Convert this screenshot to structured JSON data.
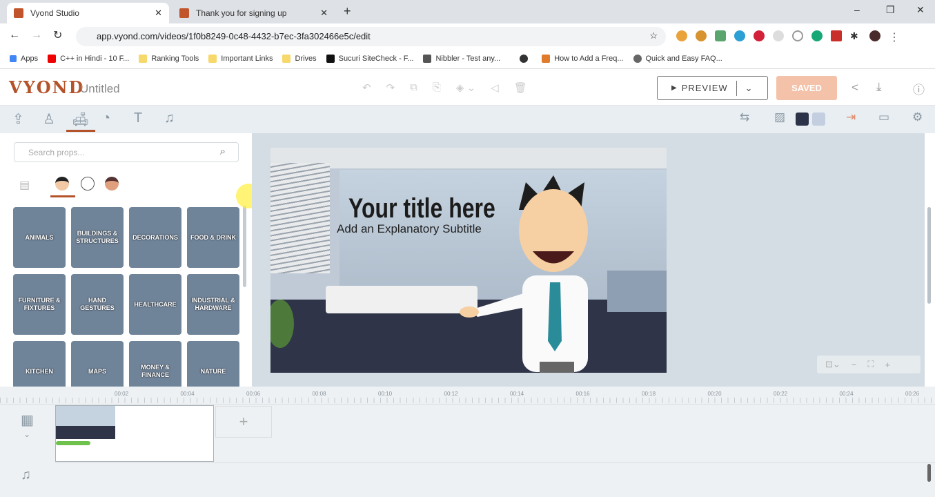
{
  "browser": {
    "tabs": [
      {
        "label": "Vyond Studio",
        "active": true
      },
      {
        "label": "Thank you for signing up",
        "active": false
      }
    ],
    "url": "app.vyond.com/videos/1f0b8249-0c48-4432-b7ec-3fa302466e5c/edit",
    "bookmarks": [
      {
        "label": "Apps"
      },
      {
        "label": "C++ in Hindi - 10 F..."
      },
      {
        "label": "Ranking Tools"
      },
      {
        "label": "Important Links"
      },
      {
        "label": "Drives"
      },
      {
        "label": "Sucuri SiteCheck - F..."
      },
      {
        "label": "Nibbler - Test any..."
      },
      {
        "label": "How to Add a Freq..."
      },
      {
        "label": "Quick and Easy FAQ..."
      }
    ]
  },
  "app": {
    "logo": "VYOND",
    "title": "Untitled",
    "preview": "PREVIEW",
    "saved": "SAVED",
    "accent": "#b4532a"
  },
  "panel": {
    "search_placeholder": "Search props...",
    "categories": [
      "ANIMALS",
      "BUILDINGS & STRUCTURES",
      "DECORATIONS",
      "FOOD & DRINK",
      "FURNITURE & FIXTURES",
      "HAND GESTURES",
      "HEALTHCARE",
      "INDUSTRIAL & HARDWARE",
      "KITCHEN",
      "MAPS",
      "MONEY & FINANCE",
      "NATURE"
    ]
  },
  "scene": {
    "title": "Your title here",
    "subtitle": "Add an Explanatory Subtitle"
  },
  "timeline": {
    "ticks": [
      "00:02",
      "00:04",
      "00:06",
      "00:08",
      "00:10",
      "00:12",
      "00:14",
      "00:16",
      "00:18",
      "00:20",
      "00:22",
      "00:24",
      "00:26"
    ],
    "add": "+"
  }
}
